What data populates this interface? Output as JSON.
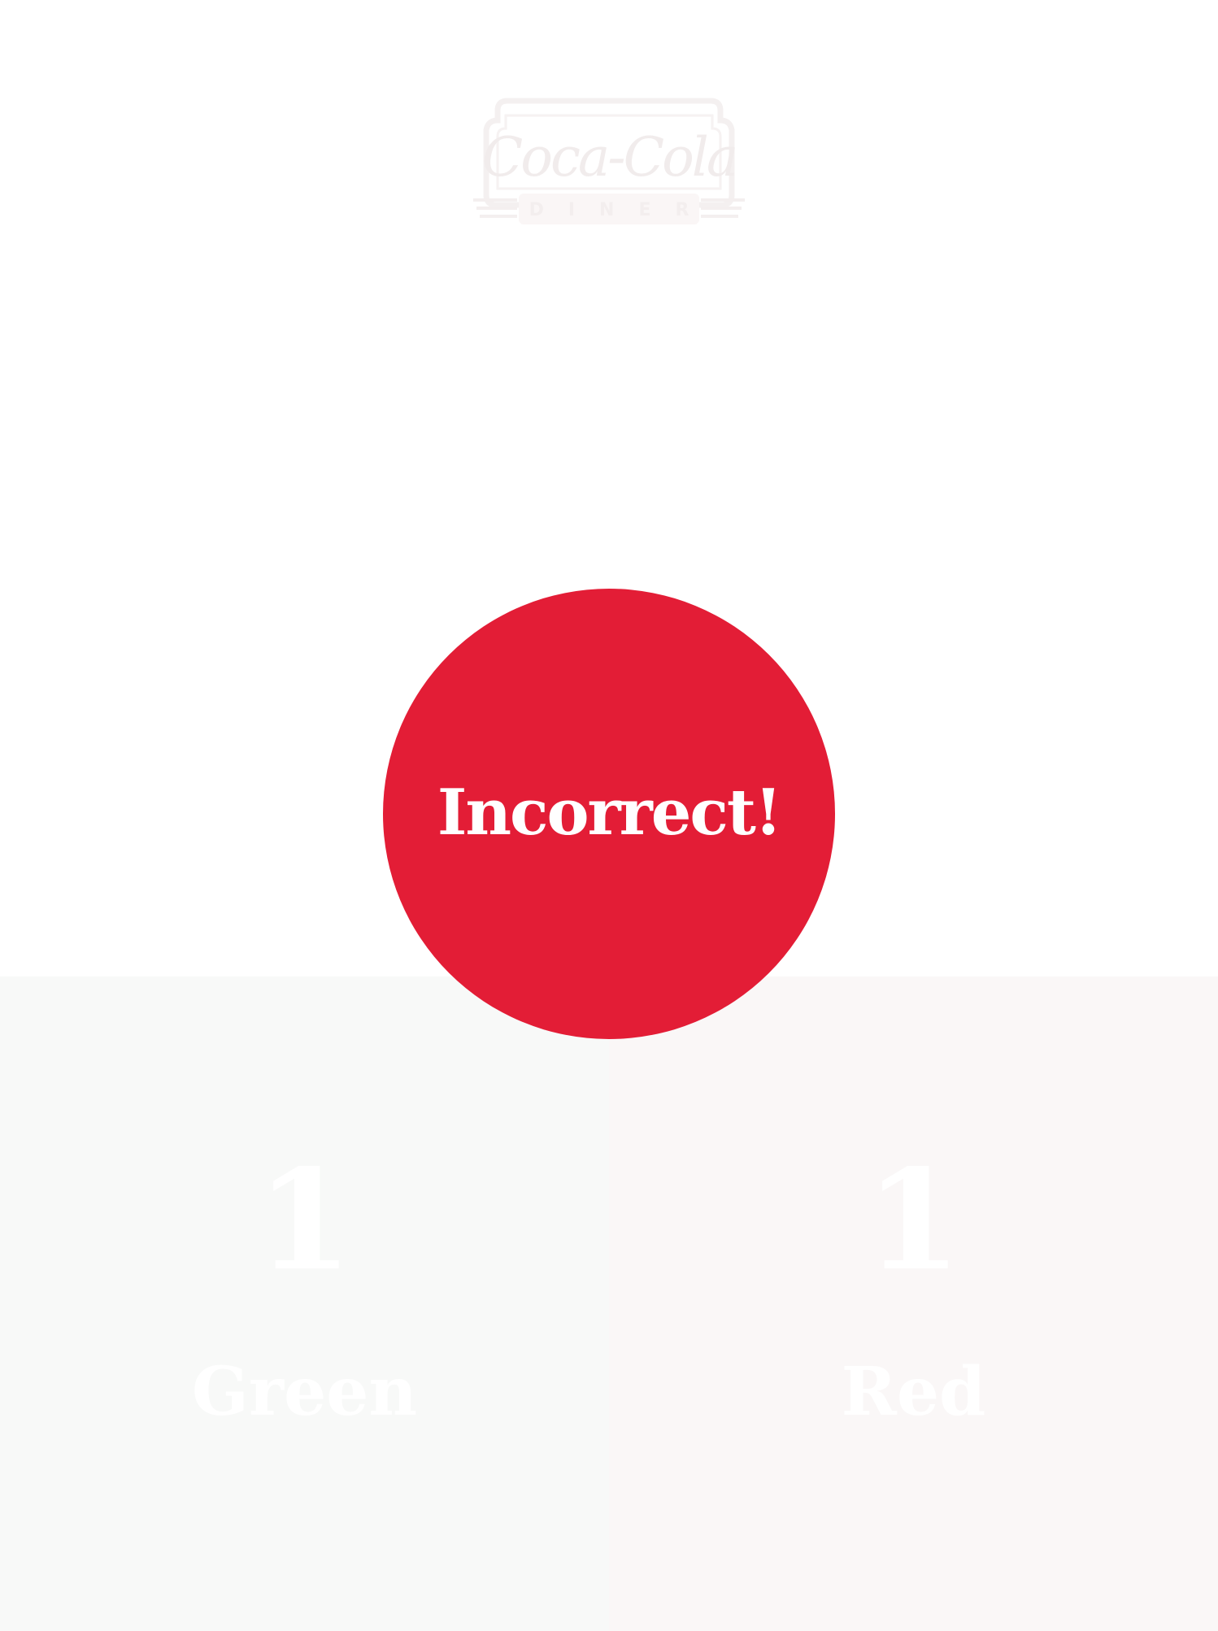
{
  "logo": {
    "brand": "Coca-Cola",
    "sub": "DINER"
  },
  "result": {
    "text": "Incorrect!",
    "color": "#e31d36"
  },
  "panels": [
    {
      "count": "1",
      "label": "Green",
      "background": "#f8f9f8"
    },
    {
      "count": "1",
      "label": "Red",
      "background": "#faf7f7"
    }
  ]
}
